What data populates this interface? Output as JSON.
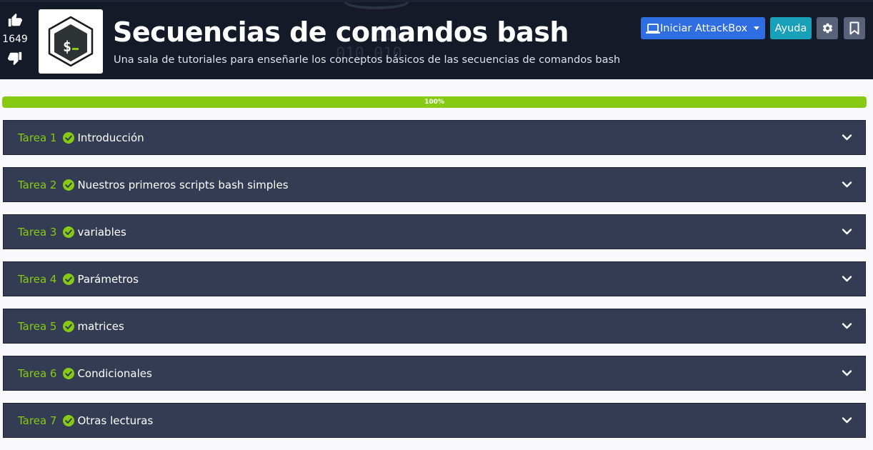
{
  "header": {
    "background_deco": "1110\n010 010",
    "votes": {
      "count": "1649",
      "upvote_icon": "thumbs-up-icon",
      "downvote_icon": "thumbs-down-icon"
    },
    "logo_icon": "bash-terminal-icon",
    "title": "Secuencias de comandos bash",
    "subtitle": "Una sala de tutoriales para enseñarle los conceptos básicos de las secuencias de comandos bash",
    "attackbox_label": "Iniciar AttackBox",
    "help_label": "Ayuda",
    "settings_icon": "gear-icon",
    "bookmark_icon": "bookmark-icon"
  },
  "progress": {
    "value": 100,
    "label": "100%"
  },
  "tasks": [
    {
      "label": "Tarea 1",
      "name": "Introducción",
      "completed": true
    },
    {
      "label": "Tarea 2",
      "name": "Nuestros primeros scripts bash simples",
      "completed": true
    },
    {
      "label": "Tarea 3",
      "name": "variables",
      "completed": true
    },
    {
      "label": "Tarea 4",
      "name": "Parámetros",
      "completed": true
    },
    {
      "label": "Tarea 5",
      "name": "matrices",
      "completed": true
    },
    {
      "label": "Tarea 6",
      "name": "Condicionales",
      "completed": true
    },
    {
      "label": "Tarea 7",
      "name": "Otras lecturas",
      "completed": true
    }
  ],
  "colors": {
    "accent_green": "#86ca14",
    "header_bg": "#141a27",
    "task_bg": "#333c52",
    "attackbox_blue": "#2f6de2",
    "help_teal": "#18a0b9"
  }
}
